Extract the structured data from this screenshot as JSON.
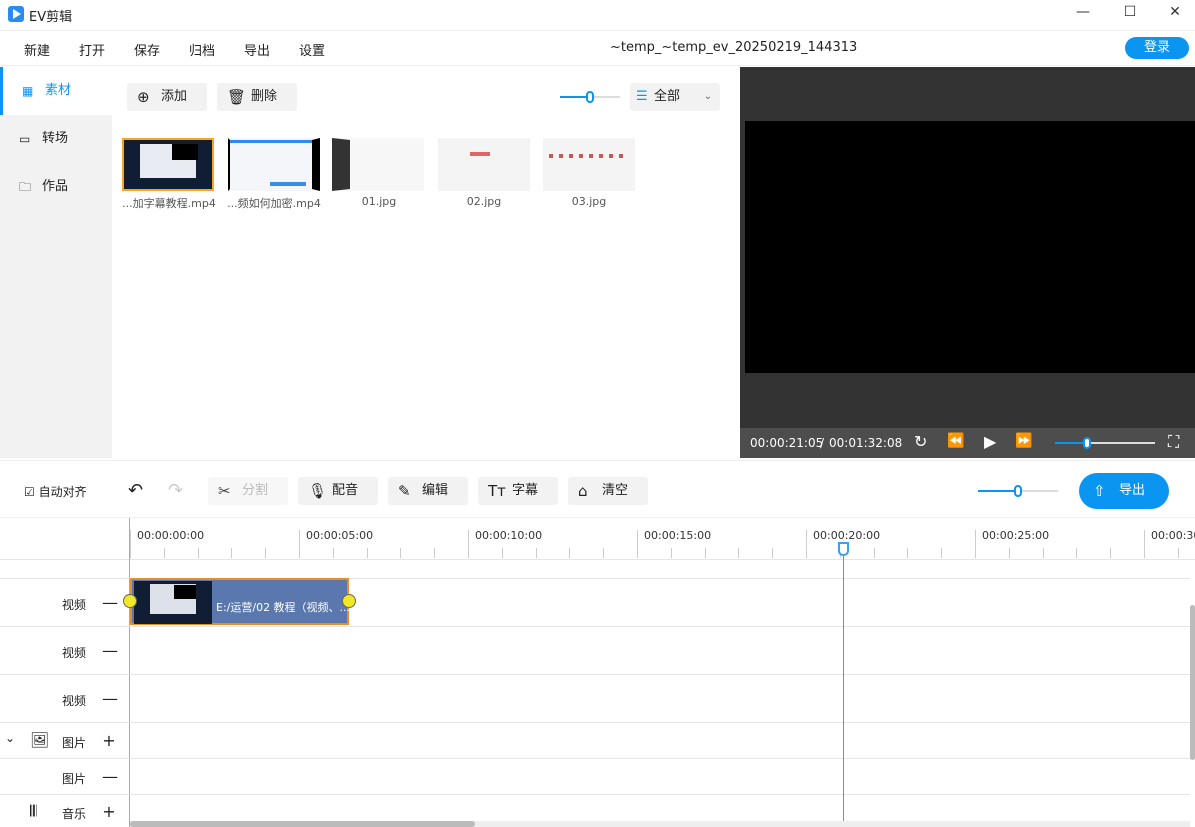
{
  "app": {
    "title": "EV剪辑",
    "project": "~temp_~temp_ev_20250219_144313",
    "login": "登录"
  },
  "window": {
    "minimize": "—",
    "maximize": "☐",
    "close": "✕"
  },
  "menu": [
    "新建",
    "打开",
    "保存",
    "归档",
    "导出",
    "设置"
  ],
  "sidebar": [
    {
      "label": "素材",
      "icon": "grid-icon",
      "active": true
    },
    {
      "label": "转场",
      "icon": "film-icon"
    },
    {
      "label": "作品",
      "icon": "folder-icon"
    }
  ],
  "media": {
    "add": "添加",
    "delete": "删除",
    "filter": "全部",
    "zoom_level": 0.5,
    "items": [
      {
        "name": "...加字幕教程.mp4",
        "selected": true
      },
      {
        "name": "...频如何加密.mp4"
      },
      {
        "name": "01.jpg"
      },
      {
        "name": "02.jpg"
      },
      {
        "name": "03.jpg"
      }
    ]
  },
  "player": {
    "current": "00:00:21:05",
    "separator": "/",
    "total": "00:01:32:08",
    "volume": 0.3
  },
  "toolbar": {
    "auto_align": "自动对齐",
    "auto_align_checked": true,
    "split": "分割",
    "dub": "配音",
    "edit": "编辑",
    "subtitle": "字幕",
    "clear": "清空",
    "export": "导出",
    "zoom_level": 0.5
  },
  "ruler": [
    "00:00:00:00",
    "00:00:05:00",
    "00:00:10:00",
    "00:00:15:00",
    "00:00:20:00",
    "00:00:25:00",
    "00:00:30"
  ],
  "tracks": [
    {
      "label": "视频",
      "action": "—"
    },
    {
      "label": "视频",
      "action": "—"
    },
    {
      "label": "视频",
      "action": "—"
    },
    {
      "label": "图片",
      "action": "+",
      "icon": "image-icon",
      "expand": "⌄"
    },
    {
      "label": "图片",
      "action": "—"
    },
    {
      "label": "音乐",
      "action": "+",
      "icon": "audio-icon"
    }
  ],
  "clip": {
    "label": "E:/运营/02 教程（视频、..."
  },
  "playhead": "00:00:21:05",
  "colors": {
    "accent": "#0a96f0",
    "clip": "#5a78ad",
    "selection": "#f5a623"
  }
}
